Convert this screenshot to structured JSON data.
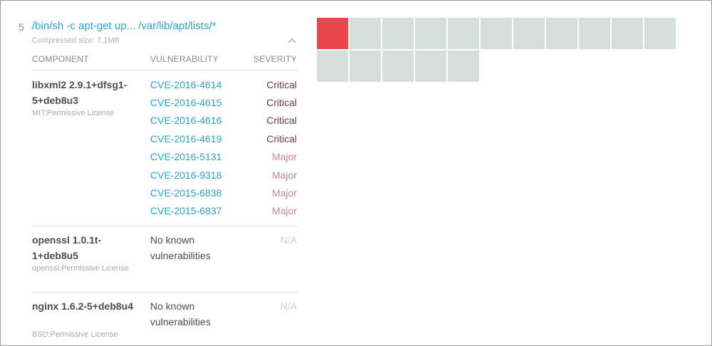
{
  "colors": {
    "link": "#2aa2cc",
    "critical": "#6e3a3e",
    "major": "#c98686",
    "na": "#cccccc",
    "cell_critical": "#e8474e",
    "cell_empty": "#d6dedc"
  },
  "layer": {
    "index": "5",
    "command": "/bin/sh -c apt-get up... /var/lib/apt/lists/*",
    "compressed_size": "Compressed size: 7.1MB",
    "toggle_icon": "chevron-up-icon"
  },
  "table": {
    "headers": {
      "component": "COMPONENT",
      "vulnerability": "VULNERABILITY",
      "severity": "SEVERITY"
    },
    "components": [
      {
        "name": "libxml2 2.9.1+dfsg1-5+deb8u3",
        "license": "MIT:Permissive License",
        "vulns": [
          {
            "id": "CVE-2016-4614",
            "severity": "Critical"
          },
          {
            "id": "CVE-2016-4615",
            "severity": "Critical"
          },
          {
            "id": "CVE-2016-4616",
            "severity": "Critical"
          },
          {
            "id": "CVE-2016-4619",
            "severity": "Critical"
          },
          {
            "id": "CVE-2016-5131",
            "severity": "Major"
          },
          {
            "id": "CVE-2016-9318",
            "severity": "Major"
          },
          {
            "id": "CVE-2015-6838",
            "severity": "Major"
          },
          {
            "id": "CVE-2015-6837",
            "severity": "Major"
          }
        ]
      },
      {
        "name": "openssl 1.0.1t-1+deb8u5",
        "license": "openssl:Permissive License",
        "no_vulns": "No known vulnerabilities",
        "severity": "N/A"
      },
      {
        "name": "nginx 1.6.2-5+deb8u4",
        "license": "BSD:Permissive License",
        "no_vulns": "No known vulnerabilities",
        "severity": "N/A"
      }
    ]
  },
  "layer_cells": {
    "rows": [
      [
        "critical",
        "empty",
        "empty",
        "empty",
        "empty",
        "empty",
        "empty",
        "empty",
        "empty",
        "empty",
        "empty"
      ],
      [
        "empty",
        "empty",
        "empty",
        "empty",
        "empty"
      ]
    ]
  }
}
